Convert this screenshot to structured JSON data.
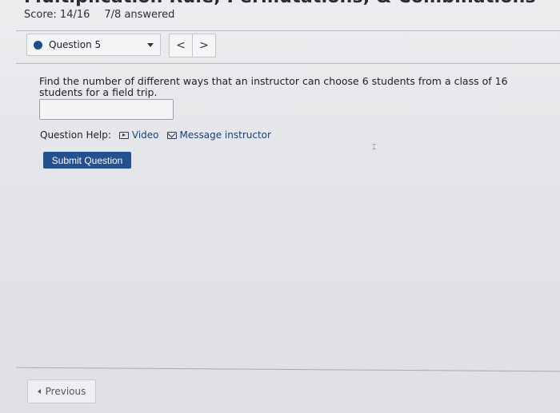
{
  "header": {
    "title": "Multiplication Rule, Permutations, & Combinations",
    "score": "Score: 14/16",
    "answered": "7/8 answered"
  },
  "question_nav": {
    "selected": "Question 5",
    "prev_symbol": "<",
    "next_symbol": ">"
  },
  "question": {
    "text": "Find the number of different ways that an instructor can choose 6 students from a class of 16 students for a field trip.",
    "answer_value": ""
  },
  "help": {
    "label": "Question Help:",
    "video": "Video",
    "message": "Message instructor"
  },
  "actions": {
    "submit": "Submit Question",
    "previous": "Previous"
  },
  "colors": {
    "accent": "#23508f",
    "dot": "#1c4f91"
  }
}
